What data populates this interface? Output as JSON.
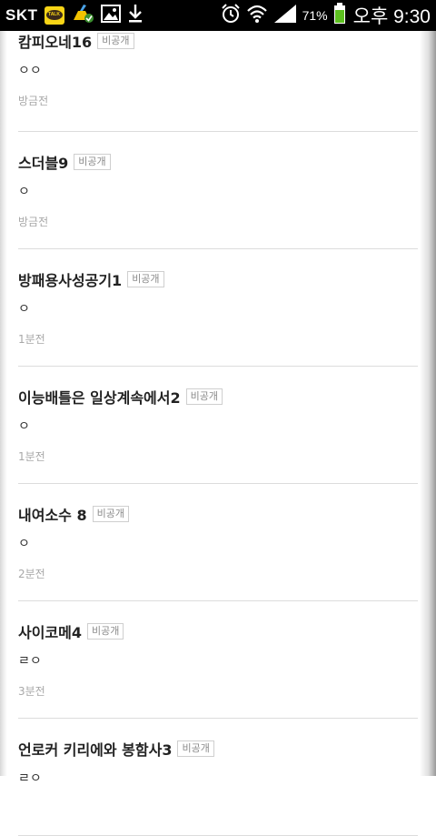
{
  "status_bar": {
    "carrier": "SKT",
    "battery_percent": "71%",
    "time": "오후 9:30",
    "talk_icon_text": "TALK"
  },
  "posts": [
    {
      "title": "캄피오네16",
      "badge": "비공개",
      "body": "ㅇㅇ",
      "time": "방금전"
    },
    {
      "title": "스더블9",
      "badge": "비공개",
      "body": "ㅇ",
      "time": "방금전"
    },
    {
      "title": "방패용사성공기1",
      "badge": "비공개",
      "body": "ㅇ",
      "time": "1분전"
    },
    {
      "title": "이능배틀은 일상계속에서2",
      "badge": "비공개",
      "body": "ㅇ",
      "time": "1분전"
    },
    {
      "title": "내여소수 8",
      "badge": "비공개",
      "body": "ㅇ",
      "time": "2분전"
    },
    {
      "title": "사이코메4",
      "badge": "비공개",
      "body": "ㄹㅇ",
      "time": "3분전"
    },
    {
      "title": "언로커 키리에와 봉함사3",
      "badge": "비공개",
      "body": "ㄹㅇ",
      "time": ""
    }
  ]
}
